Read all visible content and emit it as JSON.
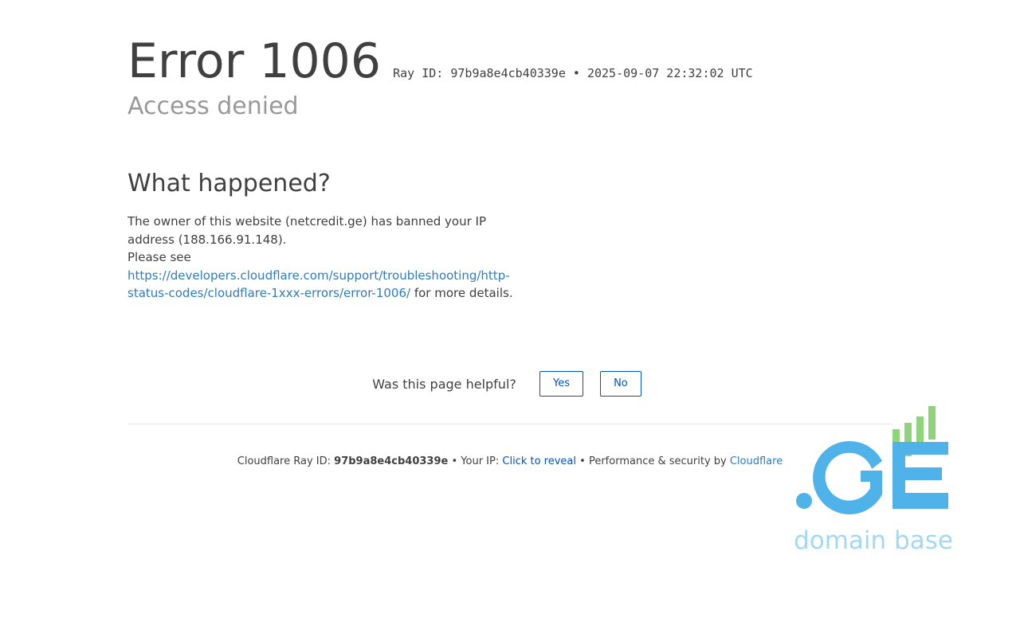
{
  "header": {
    "error_title": "Error 1006",
    "ray_id_label": "Ray ID: 97b9a8e4cb40339e •",
    "timestamp": "2025-09-07 22:32:02 UTC",
    "subtitle": "Access denied"
  },
  "main": {
    "section_title": "What happened?",
    "line1": "The owner of this website (netcredit.ge) has banned your IP address (188.166.91.148).",
    "please_see": "Please see",
    "link_text": "https://developers.cloudflare.com/support/troubleshooting/http-status-codes/cloudflare-1xxx-errors/error-1006/",
    "after_link": "for more details."
  },
  "feedback": {
    "question": "Was this page helpful?",
    "yes_label": "Yes",
    "no_label": "No"
  },
  "footer": {
    "ray_label": "Cloudflare Ray ID:",
    "ray_id": "97b9a8e4cb40339e",
    "sep1": "•",
    "ip_label": "Your IP:",
    "reveal_label": "Click to reveal",
    "sep2": "•",
    "perf_label": "Performance & security by",
    "cloudflare_label": "Cloudflare"
  },
  "logo": {
    "brand": ".GE",
    "tagline": "domain base",
    "brand_color": "#4fb3ea",
    "bars_color": "#8fd37a",
    "tagline_color": "#a3d8f4"
  }
}
